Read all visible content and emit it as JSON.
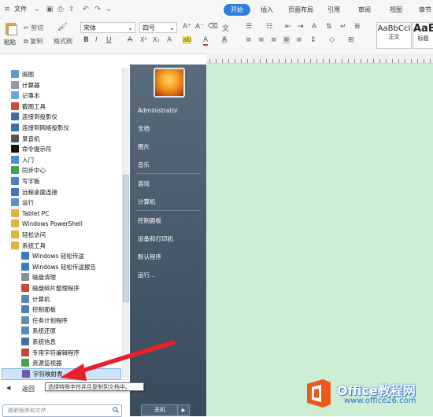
{
  "menubar": {
    "file_label": "文件",
    "tabs": [
      "开始",
      "插入",
      "页面布局",
      "引用",
      "审阅",
      "视图",
      "章节"
    ],
    "active_tab": "开始"
  },
  "toolbar": {
    "paste": "粘贴",
    "cut": "剪切",
    "copy": "复制",
    "format_painter": "格式刷",
    "font_name": "宋体",
    "font_size": "四号",
    "bold": "B",
    "italic": "I",
    "underline": "U"
  },
  "styles": [
    {
      "sample": "AaBbCcI",
      "label": "正文"
    },
    {
      "sample": "AaB",
      "label": "标题"
    }
  ],
  "start_menu": {
    "programs": [
      {
        "label": "画图",
        "color": "#5c9ad6",
        "sub": false
      },
      {
        "label": "计算器",
        "color": "#8d99a6",
        "sub": false
      },
      {
        "label": "记事本",
        "color": "#6ba6d8",
        "sub": false
      },
      {
        "label": "截图工具",
        "color": "#d24b3a",
        "sub": false
      },
      {
        "label": "连接到投影仪",
        "color": "#3b6fa8",
        "sub": false
      },
      {
        "label": "连接到网络投影仪",
        "color": "#3b6fa8",
        "sub": false
      },
      {
        "label": "录音机",
        "color": "#555555",
        "sub": false
      },
      {
        "label": "命令提示符",
        "color": "#111111",
        "sub": false
      },
      {
        "label": "入门",
        "color": "#4a8fd4",
        "sub": false
      },
      {
        "label": "同步中心",
        "color": "#3aa84a",
        "sub": false
      },
      {
        "label": "写字板",
        "color": "#4a82c2",
        "sub": false
      },
      {
        "label": "远程桌面连接",
        "color": "#3a78c0",
        "sub": false
      },
      {
        "label": "运行",
        "color": "#5a8fc8",
        "sub": false
      },
      {
        "label": "Tablet PC",
        "color": "#e3b13f",
        "sub": false
      },
      {
        "label": "Windows PowerShell",
        "color": "#e3b13f",
        "sub": false
      },
      {
        "label": "轻松访问",
        "color": "#e3b13f",
        "sub": false
      },
      {
        "label": "系统工具",
        "color": "#e3b13f",
        "sub": false
      },
      {
        "label": "Windows 轻松传送",
        "color": "#3a7bc8",
        "sub": true
      },
      {
        "label": "Windows 轻松传送报告",
        "color": "#3a7bc8",
        "sub": true
      },
      {
        "label": "磁盘清理",
        "color": "#8a8f96",
        "sub": true
      },
      {
        "label": "磁盘碎片整理程序",
        "color": "#c05030",
        "sub": true
      },
      {
        "label": "计算机",
        "color": "#5f86b3",
        "sub": true
      },
      {
        "label": "控制面板",
        "color": "#4a7fb8",
        "sub": true
      },
      {
        "label": "任务计划程序",
        "color": "#6a8aa8",
        "sub": true
      },
      {
        "label": "系统还原",
        "color": "#4f8ac0",
        "sub": true
      },
      {
        "label": "系统信息",
        "color": "#3f6fa5",
        "sub": true
      },
      {
        "label": "专用字符编辑程序",
        "color": "#c24a3a",
        "sub": true
      },
      {
        "label": "资源监视器",
        "color": "#4aa050",
        "sub": true
      },
      {
        "label": "字符映射表",
        "color": "#6a5ab0",
        "sub": true
      }
    ],
    "selected_item": "字符映射表",
    "back_label": "返回",
    "search_placeholder": "搜索程序和文件",
    "right_items": [
      "Administrator",
      "文档",
      "图片",
      "音乐",
      "游戏",
      "计算机",
      "控制面板",
      "设备和打印机",
      "默认程序",
      "运行..."
    ],
    "shutdown_label": "关机"
  },
  "tooltip": "选择特殊字符并且复制到文档中。",
  "watermark": {
    "title": "Office教程网",
    "url": "www.office26.com"
  }
}
